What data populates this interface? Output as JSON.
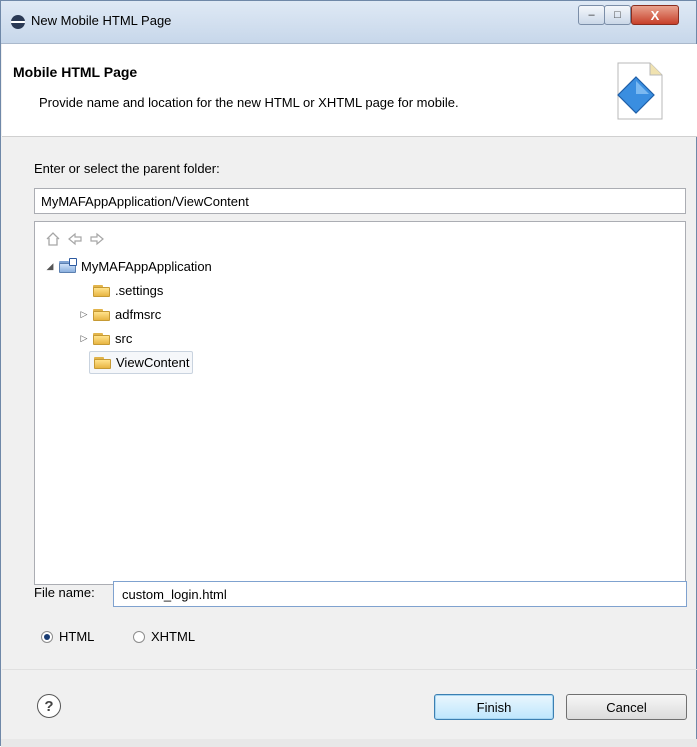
{
  "window": {
    "title": "New Mobile HTML Page",
    "controls": {
      "minimize": "–",
      "maximize": "□",
      "close": "X"
    }
  },
  "banner": {
    "title": "Mobile HTML Page",
    "description": "Provide name and location for the new HTML or XHTML page for mobile."
  },
  "parent": {
    "label": "Enter or select the parent folder:",
    "value": "MyMAFAppApplication/ViewContent"
  },
  "tree": {
    "nav_icons": [
      "home-icon",
      "back-arrow-icon",
      "forward-arrow-icon"
    ],
    "items": [
      {
        "label": "MyMAFAppApplication",
        "level": 0,
        "expander": "expanded",
        "type": "project"
      },
      {
        "label": ".settings",
        "level": 1,
        "expander": "none",
        "type": "folder"
      },
      {
        "label": "adfmsrc",
        "level": 1,
        "expander": "collapsed",
        "type": "folder"
      },
      {
        "label": "src",
        "level": 1,
        "expander": "collapsed",
        "type": "folder"
      },
      {
        "label": "ViewContent",
        "level": 1,
        "expander": "none",
        "type": "folder",
        "selected": true
      }
    ]
  },
  "file": {
    "label": "File name:",
    "value": "custom_login.html"
  },
  "format": {
    "options": [
      "HTML",
      "XHTML"
    ],
    "selected": "HTML"
  },
  "buttons": {
    "help": "?",
    "finish": "Finish",
    "cancel": "Cancel"
  }
}
